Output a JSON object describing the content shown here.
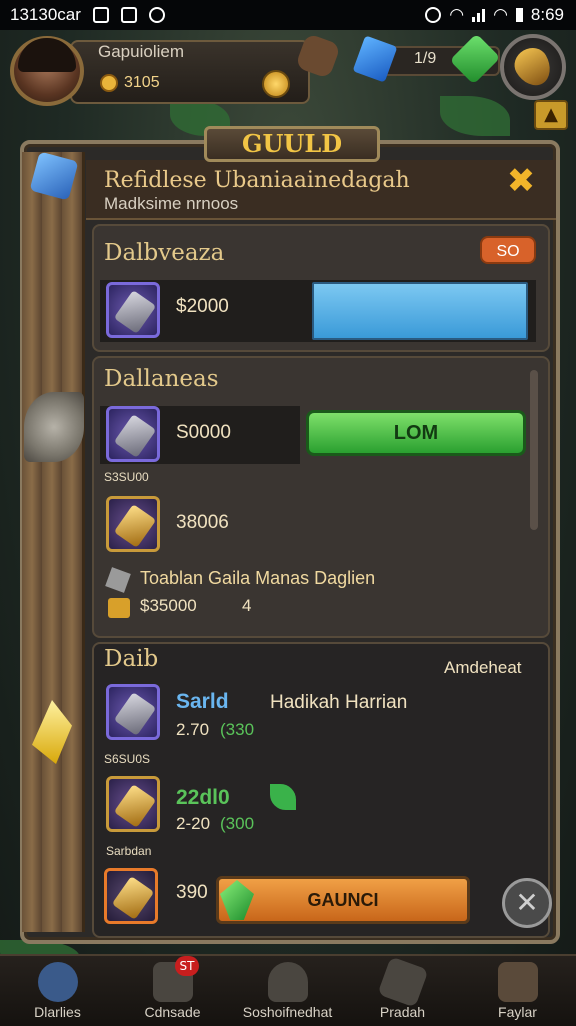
{
  "status_bar": {
    "time_left": "13130car",
    "time_right": "8:69"
  },
  "hud": {
    "player_name": "Gapuioliem",
    "gold": "3105",
    "resource_count": "1/9"
  },
  "panel": {
    "title": "GUULD",
    "header_title": "Refidlese Ubaniaainedagah",
    "header_subtitle": "Madksime nrnoos",
    "close_label": "✖"
  },
  "section1": {
    "heading": "Dalbveaza",
    "badge": "SO",
    "row_value": "$2000"
  },
  "section2": {
    "heading": "Dallaneas",
    "row1_value": "S0000",
    "row1_sub": "S3SU00",
    "button_label": "LOM",
    "row2_value": "38006",
    "footer_text": "Toablan Gaila Manas Daglien",
    "footer_amount": "$35000",
    "footer_count": "4"
  },
  "section3": {
    "heading": "Daib",
    "right_label": "Amdeheat",
    "row1_name": "Sarld",
    "row1_title": "Hadikah Harrian",
    "row1_price": "2.70",
    "row1_price_alt": "(330",
    "row1_sub": "S6SU0S",
    "row2_name": "22dl0",
    "row2_price": "2-20",
    "row2_price_alt": "(300",
    "row2_sub": "Sarbdan",
    "row3_value": "390",
    "button_label": "GAUNCI",
    "close_label": "✕"
  },
  "nav": [
    {
      "label": "Dlarlies",
      "icon": "compass-icon",
      "badge": ""
    },
    {
      "label": "Cdnsade",
      "icon": "chat-icon",
      "badge": "ST"
    },
    {
      "label": "Soshoifnedhat",
      "icon": "helmet-icon",
      "badge": ""
    },
    {
      "label": "Pradah",
      "icon": "gear-icon",
      "badge": ""
    },
    {
      "label": "Faylar",
      "icon": "settings-icon",
      "badge": ""
    }
  ]
}
